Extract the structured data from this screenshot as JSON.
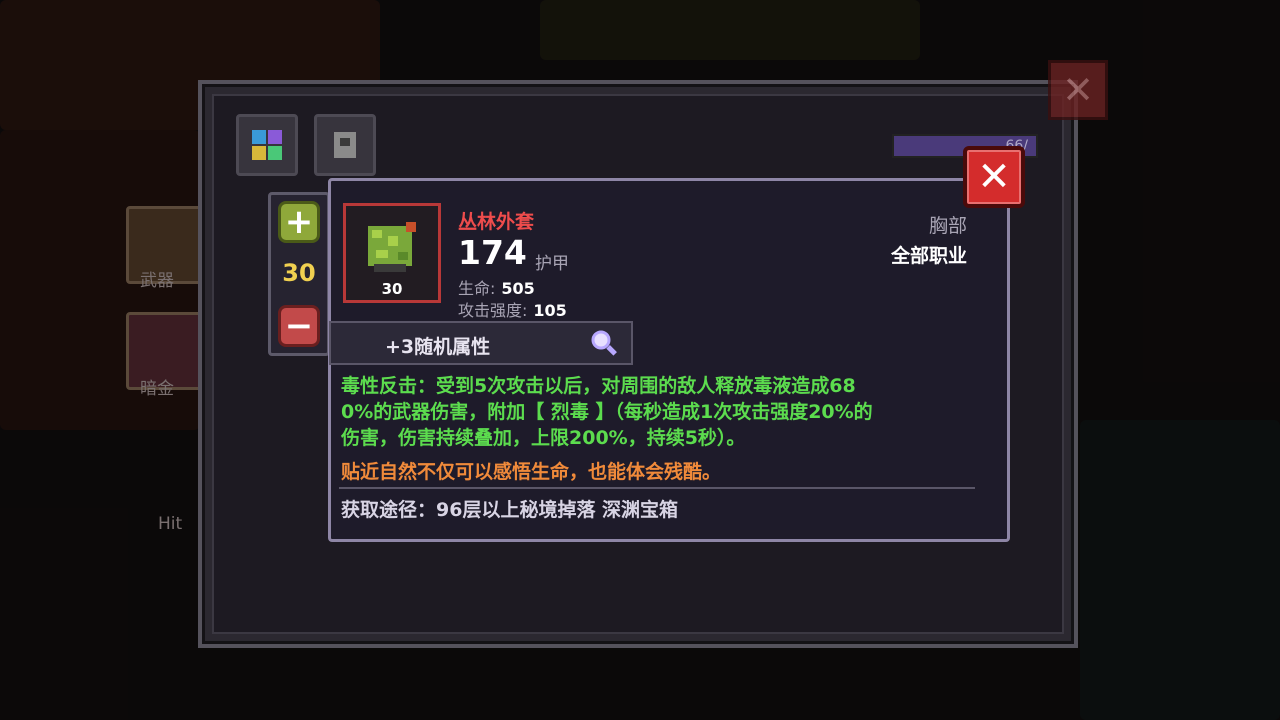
{
  "background": {
    "labels": [
      "武器",
      "暗金",
      "Hit"
    ]
  },
  "outer_window": {
    "hp_text": "66/"
  },
  "quantity": {
    "value": "30",
    "plus_icon": "plus-icon",
    "minus_icon": "minus-icon"
  },
  "item": {
    "name": "丛林外套",
    "level": "30",
    "armor_value": "174",
    "armor_label": "护甲",
    "stats": [
      {
        "label": "生命:",
        "value": "505"
      },
      {
        "label": "攻击强度:",
        "value": "105"
      }
    ],
    "slot": "胸部",
    "class": "全部职业",
    "random_attr_label": "+3随机属性",
    "effect_lines": [
      "毒性反击：受到5次攻击以后，对周围的敌人释放毒液造成68",
      "0%的武器伤害，附加【 烈毒 】（每秒造成1次攻击强度20%的",
      "伤害，伤害持续叠加，上限200%，持续5秒）。"
    ],
    "flavor": "贴近自然不仅可以感悟生命，也能体会残酷。",
    "source": "获取途径：96层以上秘境掉落 深渊宝箱"
  },
  "colors": {
    "item_name": "#ee4c4c",
    "effect": "#5cdc4e",
    "flavor": "#f08a3a",
    "close": "#d42c2c"
  }
}
